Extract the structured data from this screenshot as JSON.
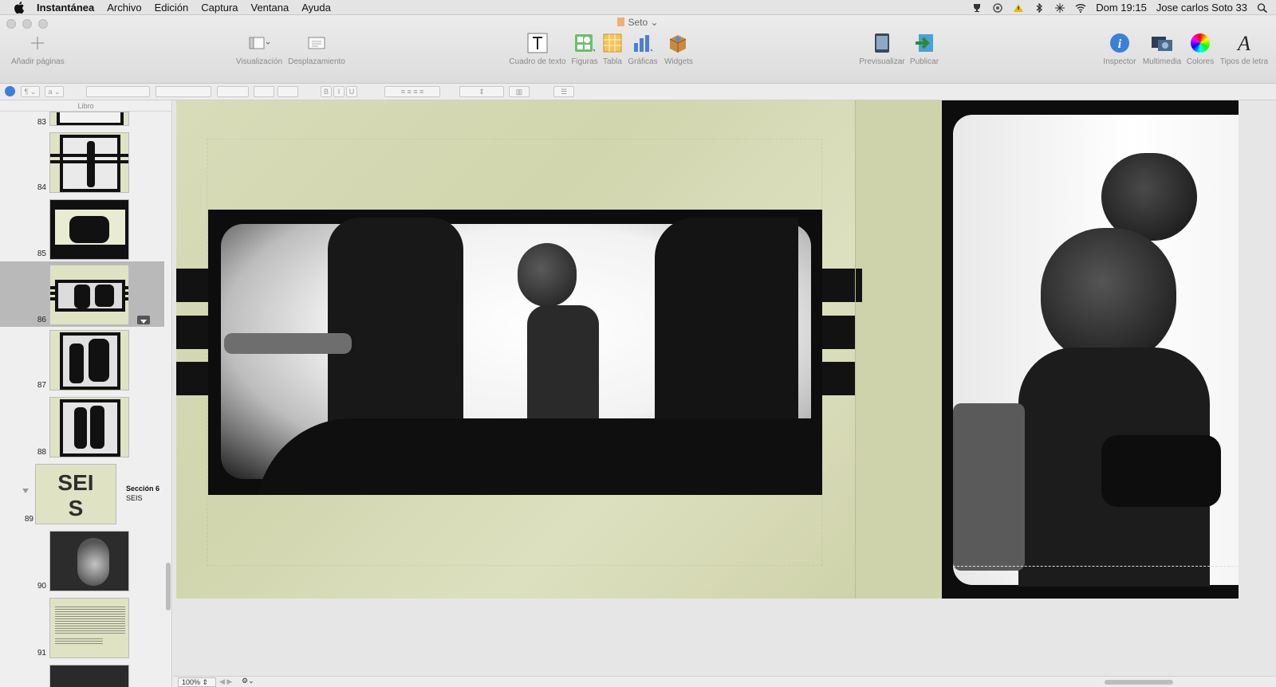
{
  "menubar": {
    "app_name": "Instantánea",
    "items": [
      "Archivo",
      "Edición",
      "Captura",
      "Ventana",
      "Ayuda"
    ],
    "clock": "Dom 19:15",
    "user": "Jose carlos Soto 33"
  },
  "window": {
    "document_title": "Seto"
  },
  "toolbar": {
    "add_pages": "Añadir páginas",
    "view": "Visualización",
    "scroll": "Desplazamiento",
    "textbox": "Cuadro de texto",
    "shapes": "Figuras",
    "table": "Tabla",
    "charts": "Gráficas",
    "widgets": "Widgets",
    "preview": "Previsualizar",
    "publish": "Publicar",
    "inspector": "Inspector",
    "media": "Multimedia",
    "colors": "Colores",
    "fonts": "Tipos de letra"
  },
  "formatbar": {
    "paragraph_symbol": "¶",
    "char_style": "a",
    "bold": "B",
    "italic": "I",
    "underline": "U"
  },
  "sidebar": {
    "header": "Libro",
    "pages": [
      {
        "num": "83"
      },
      {
        "num": "84"
      },
      {
        "num": "85"
      },
      {
        "num": "86"
      },
      {
        "num": "87"
      },
      {
        "num": "88"
      },
      {
        "num": "89",
        "thumb_text_1": "SEI",
        "thumb_text_2": "S",
        "section_title": "Sección 6",
        "section_sub": "SEIS"
      },
      {
        "num": "90"
      },
      {
        "num": "91"
      }
    ]
  },
  "bottombar": {
    "zoom": "100%"
  },
  "colors": {
    "page_background": "#d5d9b3",
    "stripe": "#121212",
    "selected_row": "#b9b9b9"
  }
}
